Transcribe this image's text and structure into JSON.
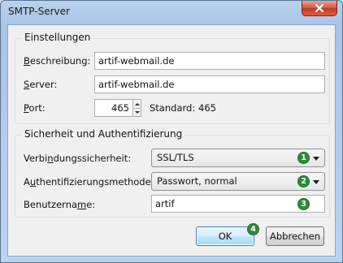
{
  "window": {
    "title": "SMTP-Server"
  },
  "settings": {
    "legend": "Einstellungen",
    "description_label_u": "B",
    "description_label_rest": "eschreibung:",
    "description_value": "artif-webmail.de",
    "server_label_u": "S",
    "server_label_rest": "erver:",
    "server_value": "artif-webmail.de",
    "port_label_u": "P",
    "port_label_rest": "ort:",
    "port_value": "465",
    "standard_label": "Standard:",
    "standard_value": "465"
  },
  "security": {
    "legend": "Sicherheit und Authentifizierung",
    "connection_label_pre": "Verbi",
    "connection_label_u": "n",
    "connection_label_post": "dungssicherheit:",
    "connection_value": "SSL/TLS",
    "auth_label_pre": "A",
    "auth_label_u": "u",
    "auth_label_post": "thentifizierungsmethode:",
    "auth_value": "Passwort, normal",
    "username_label_pre": "Benutzerna",
    "username_label_u": "m",
    "username_label_post": "e:",
    "username_value": "artif"
  },
  "badges": [
    "1",
    "2",
    "3",
    "4"
  ],
  "buttons": {
    "ok": "OK",
    "cancel": "Abbrechen"
  },
  "icons": {
    "close": "close-icon"
  },
  "colors": {
    "badge": "#2e8b3a",
    "close_button": "#c13a22"
  }
}
